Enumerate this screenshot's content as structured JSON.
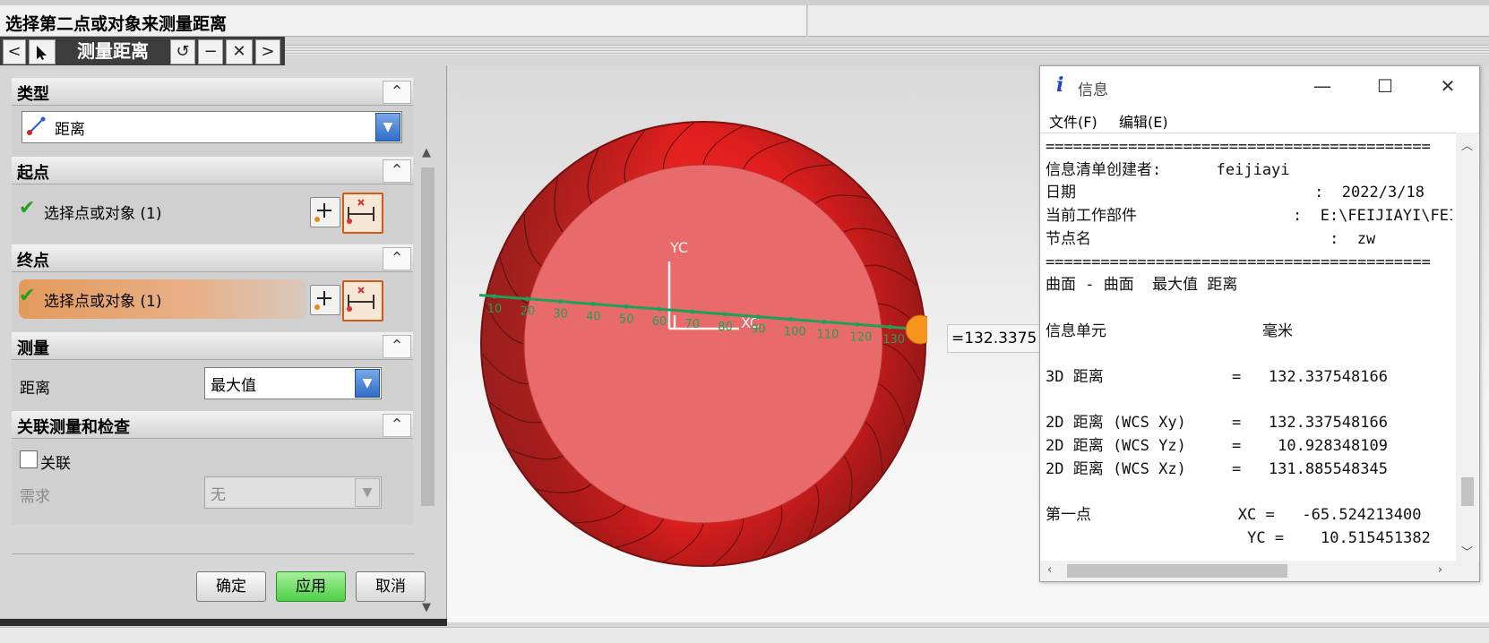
{
  "cue_line": "选择第二点或对象来测量距离",
  "dialog": {
    "title": "测量距离",
    "toolbar": {
      "back": "<",
      "reset": "↺",
      "minimize": "−",
      "close": "✕",
      "forward": ">"
    },
    "sections": {
      "type": {
        "label": "类型",
        "value": "距离"
      },
      "start": {
        "label": "起点",
        "select_text": "选择点或对象 (1)"
      },
      "end": {
        "label": "终点",
        "select_text": "选择点或对象 (1)"
      },
      "measure": {
        "label": "测量",
        "field_label": "距离",
        "value": "最大值"
      },
      "assoc": {
        "label": "关联测量和检查",
        "checkbox_label": "关联",
        "requirement_label": "需求",
        "requirement_value": "无"
      }
    },
    "buttons": {
      "ok": "确定",
      "apply": "应用",
      "cancel": "取消"
    }
  },
  "viewport": {
    "axis_label_y": "YC",
    "axis_label_x": "XC",
    "measure_value": "=132.3375",
    "ruler_ticks": [
      "10",
      "20",
      "30",
      "40",
      "50",
      "60",
      "70",
      "80",
      "90",
      "100",
      "110",
      "120",
      "130"
    ]
  },
  "info_window": {
    "title": "信息",
    "menu": {
      "file": "文件(F)",
      "edit": "编辑(E)"
    },
    "lines": [
      "==========================================",
      "信息清单创建者:      feijiayi",
      "日期                          :  2022/3/18",
      "当前工作部件                 :  E:\\FEIJIAYI\\FEI",
      "节点名                          :  zw",
      "==========================================",
      "曲面 - 曲面  最大值 距离",
      "",
      "信息单元                 毫米",
      "",
      "3D 距离              =   132.337548166",
      "",
      "2D 距离 (WCS Xy)     =   132.337548166",
      "2D 距离 (WCS Yz)     =    10.928348109",
      "2D 距离 (WCS Xz)     =   131.885548345",
      "",
      "第一点                XC =   -65.524213400",
      "                      YC =    10.515451382"
    ]
  },
  "colors": {
    "model_outer": "#d42222",
    "model_inner": "#e86a6a",
    "measure_line": "#1fa05a",
    "accent_orange": "#d25a12",
    "apply_green": "#4fcf47"
  }
}
